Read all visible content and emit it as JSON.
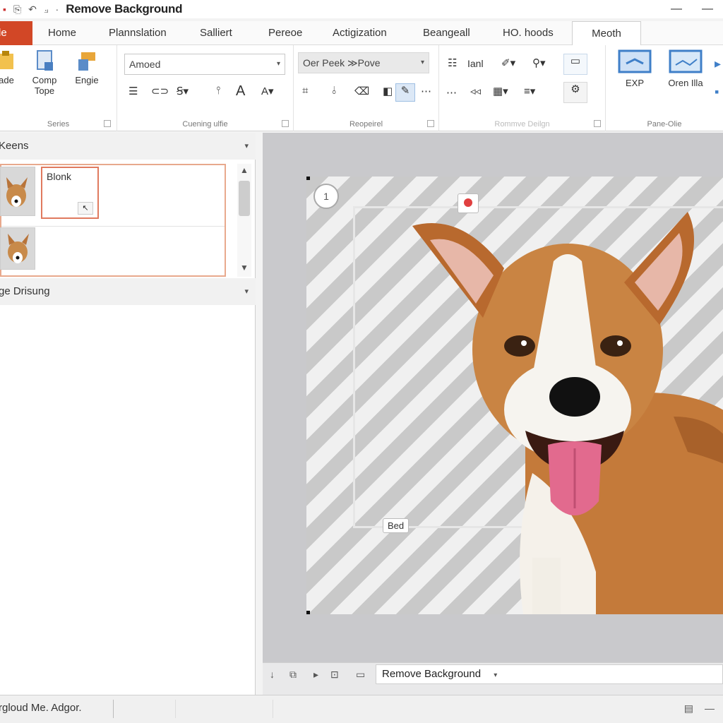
{
  "window": {
    "title": "Remove Background",
    "minimize_glyph": "—",
    "close_glyph": "—"
  },
  "tabs": [
    {
      "label": "le",
      "name": "file",
      "active": false
    },
    {
      "label": "Home",
      "active": false
    },
    {
      "label": "Plannslation",
      "active": false
    },
    {
      "label": "Salliert",
      "active": false
    },
    {
      "label": "Pereoe",
      "active": false
    },
    {
      "label": "Actigization",
      "active": false
    },
    {
      "label": "Beangeall",
      "active": false
    },
    {
      "label": "HO. hoods",
      "active": false
    },
    {
      "label": "Meoth",
      "active": true
    }
  ],
  "ribbon": {
    "groups": {
      "series": {
        "label": "Series",
        "buttons": [
          {
            "label": "ade",
            "icon": "paste-icon"
          },
          {
            "label": "Comp Tope",
            "icon": "document-icon"
          },
          {
            "label": "Engie",
            "icon": "format-icon"
          }
        ]
      },
      "formatting": {
        "label": "Cuening ulfie",
        "font_value": "Amoed",
        "font_dropdown_glyph": "▾"
      },
      "properties": {
        "label": "Reopeirel",
        "style_value": "Oer Peek ≫Pove",
        "style_dropdown_glyph": "▾"
      },
      "remove_design": {
        "label": "Rommve Deilgn",
        "item_label": "Ianl"
      },
      "panes": {
        "label": "Pane-Olie",
        "buttons": [
          {
            "label": "EXP",
            "icon": "screen-icon"
          },
          {
            "label": "Oren Illa",
            "icon": "monitor-icon"
          }
        ]
      }
    }
  },
  "left_pane": {
    "slides_header": "Keens",
    "slides": [
      {
        "label": "Blonk",
        "selected": true
      }
    ],
    "section_header": "ge Drisung",
    "dropdown_glyph": "▾"
  },
  "canvas": {
    "marker_label": "Bed",
    "magnifier_glyph": "1"
  },
  "bottom_bar": {
    "dropdown_value": "Remove Background",
    "dropdown_glyph": "▾"
  },
  "status_bar": {
    "text": "rgloud Me. Adgor."
  },
  "colors": {
    "file_tab": "#d24726",
    "selection_border": "#e07a5f",
    "stripe_dark": "#c9c9c9",
    "stripe_light": "#f0f0f0"
  }
}
